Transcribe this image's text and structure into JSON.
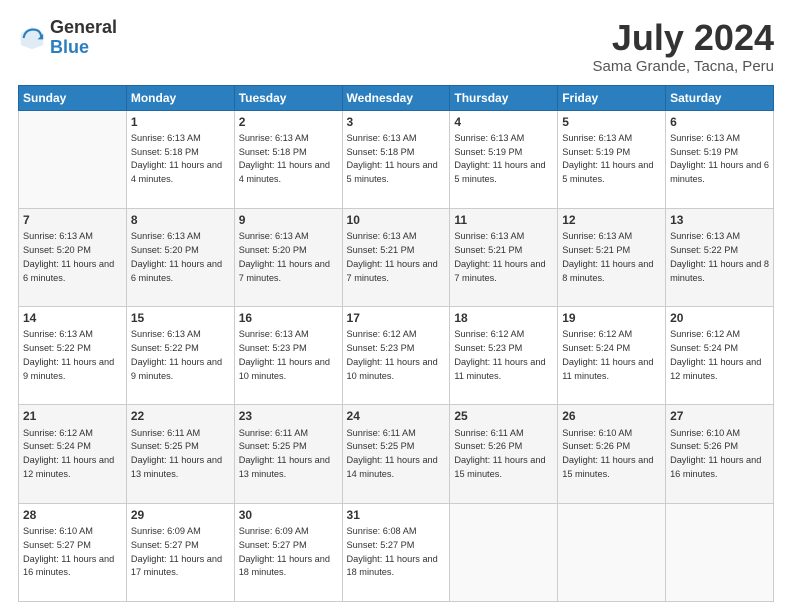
{
  "header": {
    "logo_general": "General",
    "logo_blue": "Blue",
    "month_title": "July 2024",
    "location": "Sama Grande, Tacna, Peru"
  },
  "days_of_week": [
    "Sunday",
    "Monday",
    "Tuesday",
    "Wednesday",
    "Thursday",
    "Friday",
    "Saturday"
  ],
  "weeks": [
    [
      {
        "day": "",
        "sunrise": "",
        "sunset": "",
        "daylight": ""
      },
      {
        "day": "1",
        "sunrise": "Sunrise: 6:13 AM",
        "sunset": "Sunset: 5:18 PM",
        "daylight": "Daylight: 11 hours and 4 minutes."
      },
      {
        "day": "2",
        "sunrise": "Sunrise: 6:13 AM",
        "sunset": "Sunset: 5:18 PM",
        "daylight": "Daylight: 11 hours and 4 minutes."
      },
      {
        "day": "3",
        "sunrise": "Sunrise: 6:13 AM",
        "sunset": "Sunset: 5:18 PM",
        "daylight": "Daylight: 11 hours and 5 minutes."
      },
      {
        "day": "4",
        "sunrise": "Sunrise: 6:13 AM",
        "sunset": "Sunset: 5:19 PM",
        "daylight": "Daylight: 11 hours and 5 minutes."
      },
      {
        "day": "5",
        "sunrise": "Sunrise: 6:13 AM",
        "sunset": "Sunset: 5:19 PM",
        "daylight": "Daylight: 11 hours and 5 minutes."
      },
      {
        "day": "6",
        "sunrise": "Sunrise: 6:13 AM",
        "sunset": "Sunset: 5:19 PM",
        "daylight": "Daylight: 11 hours and 6 minutes."
      }
    ],
    [
      {
        "day": "7",
        "sunrise": "Sunrise: 6:13 AM",
        "sunset": "Sunset: 5:20 PM",
        "daylight": "Daylight: 11 hours and 6 minutes."
      },
      {
        "day": "8",
        "sunrise": "Sunrise: 6:13 AM",
        "sunset": "Sunset: 5:20 PM",
        "daylight": "Daylight: 11 hours and 6 minutes."
      },
      {
        "day": "9",
        "sunrise": "Sunrise: 6:13 AM",
        "sunset": "Sunset: 5:20 PM",
        "daylight": "Daylight: 11 hours and 7 minutes."
      },
      {
        "day": "10",
        "sunrise": "Sunrise: 6:13 AM",
        "sunset": "Sunset: 5:21 PM",
        "daylight": "Daylight: 11 hours and 7 minutes."
      },
      {
        "day": "11",
        "sunrise": "Sunrise: 6:13 AM",
        "sunset": "Sunset: 5:21 PM",
        "daylight": "Daylight: 11 hours and 7 minutes."
      },
      {
        "day": "12",
        "sunrise": "Sunrise: 6:13 AM",
        "sunset": "Sunset: 5:21 PM",
        "daylight": "Daylight: 11 hours and 8 minutes."
      },
      {
        "day": "13",
        "sunrise": "Sunrise: 6:13 AM",
        "sunset": "Sunset: 5:22 PM",
        "daylight": "Daylight: 11 hours and 8 minutes."
      }
    ],
    [
      {
        "day": "14",
        "sunrise": "Sunrise: 6:13 AM",
        "sunset": "Sunset: 5:22 PM",
        "daylight": "Daylight: 11 hours and 9 minutes."
      },
      {
        "day": "15",
        "sunrise": "Sunrise: 6:13 AM",
        "sunset": "Sunset: 5:22 PM",
        "daylight": "Daylight: 11 hours and 9 minutes."
      },
      {
        "day": "16",
        "sunrise": "Sunrise: 6:13 AM",
        "sunset": "Sunset: 5:23 PM",
        "daylight": "Daylight: 11 hours and 10 minutes."
      },
      {
        "day": "17",
        "sunrise": "Sunrise: 6:12 AM",
        "sunset": "Sunset: 5:23 PM",
        "daylight": "Daylight: 11 hours and 10 minutes."
      },
      {
        "day": "18",
        "sunrise": "Sunrise: 6:12 AM",
        "sunset": "Sunset: 5:23 PM",
        "daylight": "Daylight: 11 hours and 11 minutes."
      },
      {
        "day": "19",
        "sunrise": "Sunrise: 6:12 AM",
        "sunset": "Sunset: 5:24 PM",
        "daylight": "Daylight: 11 hours and 11 minutes."
      },
      {
        "day": "20",
        "sunrise": "Sunrise: 6:12 AM",
        "sunset": "Sunset: 5:24 PM",
        "daylight": "Daylight: 11 hours and 12 minutes."
      }
    ],
    [
      {
        "day": "21",
        "sunrise": "Sunrise: 6:12 AM",
        "sunset": "Sunset: 5:24 PM",
        "daylight": "Daylight: 11 hours and 12 minutes."
      },
      {
        "day": "22",
        "sunrise": "Sunrise: 6:11 AM",
        "sunset": "Sunset: 5:25 PM",
        "daylight": "Daylight: 11 hours and 13 minutes."
      },
      {
        "day": "23",
        "sunrise": "Sunrise: 6:11 AM",
        "sunset": "Sunset: 5:25 PM",
        "daylight": "Daylight: 11 hours and 13 minutes."
      },
      {
        "day": "24",
        "sunrise": "Sunrise: 6:11 AM",
        "sunset": "Sunset: 5:25 PM",
        "daylight": "Daylight: 11 hours and 14 minutes."
      },
      {
        "day": "25",
        "sunrise": "Sunrise: 6:11 AM",
        "sunset": "Sunset: 5:26 PM",
        "daylight": "Daylight: 11 hours and 15 minutes."
      },
      {
        "day": "26",
        "sunrise": "Sunrise: 6:10 AM",
        "sunset": "Sunset: 5:26 PM",
        "daylight": "Daylight: 11 hours and 15 minutes."
      },
      {
        "day": "27",
        "sunrise": "Sunrise: 6:10 AM",
        "sunset": "Sunset: 5:26 PM",
        "daylight": "Daylight: 11 hours and 16 minutes."
      }
    ],
    [
      {
        "day": "28",
        "sunrise": "Sunrise: 6:10 AM",
        "sunset": "Sunset: 5:27 PM",
        "daylight": "Daylight: 11 hours and 16 minutes."
      },
      {
        "day": "29",
        "sunrise": "Sunrise: 6:09 AM",
        "sunset": "Sunset: 5:27 PM",
        "daylight": "Daylight: 11 hours and 17 minutes."
      },
      {
        "day": "30",
        "sunrise": "Sunrise: 6:09 AM",
        "sunset": "Sunset: 5:27 PM",
        "daylight": "Daylight: 11 hours and 18 minutes."
      },
      {
        "day": "31",
        "sunrise": "Sunrise: 6:08 AM",
        "sunset": "Sunset: 5:27 PM",
        "daylight": "Daylight: 11 hours and 18 minutes."
      },
      {
        "day": "",
        "sunrise": "",
        "sunset": "",
        "daylight": ""
      },
      {
        "day": "",
        "sunrise": "",
        "sunset": "",
        "daylight": ""
      },
      {
        "day": "",
        "sunrise": "",
        "sunset": "",
        "daylight": ""
      }
    ]
  ]
}
